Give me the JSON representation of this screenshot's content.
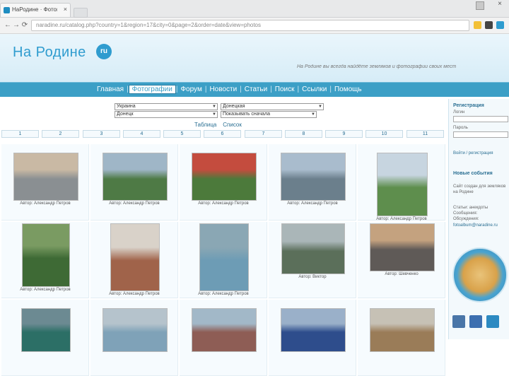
{
  "browser": {
    "tab_title": "НаРодине · Фотографии",
    "close_glyph": "×",
    "url": "naradine.ru/catalog.php?country=1&region=17&city=0&page=2&order=date&view=photos",
    "back": "←",
    "forward": "→",
    "reload": "⟳"
  },
  "site": {
    "logo_text": "На Родине",
    "logo_badge": "ru",
    "slogan": "На Родине вы всегда найдёте земляков и фотографии своих мест",
    "accent": "#3c9fc6"
  },
  "nav": {
    "items": [
      "Главная",
      "Фотографии",
      "Форум",
      "Новости",
      "Статьи",
      "Поиск",
      "Ссылки",
      "Помощь"
    ],
    "active_index": 1
  },
  "filters": {
    "country": "Украина",
    "region": "Донецкая",
    "city": "Донецк",
    "sort": "Показывать сначала"
  },
  "view_links": [
    "Таблица",
    "Список"
  ],
  "pager": [
    "1",
    "2",
    "3",
    "4",
    "5",
    "6",
    "7",
    "8",
    "9",
    "10",
    "11"
  ],
  "photos": [
    {
      "color": "#8a8f92",
      "alt": "#c9b9a4",
      "author": "Автор: Александр Петров"
    },
    {
      "color": "#4e7a45",
      "alt": "#9fb6c7",
      "author": "Автор: Александр Петров"
    },
    {
      "color": "#4c7a3b",
      "alt": "#c44c3e",
      "author": "Автор: Александр Петров"
    },
    {
      "color": "#6b7f8c",
      "alt": "#a9bccd",
      "author": "Автор: Александр Петров"
    },
    {
      "color": "#5e8e4d",
      "alt": "#c7d5e0",
      "author": "Автор: Александр Петров"
    },
    {
      "color": "#3e6a35",
      "alt": "#7a9b62",
      "author": "Автор: Александр Петров"
    },
    {
      "color": "#a0634a",
      "alt": "#d9d2c9",
      "author": "Автор: Александр Петров"
    },
    {
      "color": "#6d9cb5",
      "alt": "#8aa7b4",
      "author": "Автор: Александр Петров"
    },
    {
      "color": "#5b6f5a",
      "alt": "#aab6b8",
      "author": "Автор: Виктор"
    },
    {
      "color": "#5f5a57",
      "alt": "#c4a27f",
      "author": "Автор: Шевченко"
    },
    {
      "color": "#2c6f66",
      "alt": "#6c8a92",
      "author": ""
    },
    {
      "color": "#7fa2b8",
      "alt": "#b5c3cc",
      "author": ""
    },
    {
      "color": "#8e5d55",
      "alt": "#a2b8c8",
      "author": ""
    },
    {
      "color": "#2e4d8c",
      "alt": "#9ab0c9",
      "author": ""
    },
    {
      "color": "#9a7c58",
      "alt": "#c6c1b5",
      "author": ""
    }
  ],
  "sidebar": {
    "login_title": "Регистрация",
    "login_label": "Логин",
    "password_label": "Пароль",
    "login_button": "Войти / регистрация",
    "section2_title": "Новые события",
    "section2_text": [
      "Сайт создан для земляков",
      "на Родине"
    ],
    "section3_text": [
      "Статьи: анекдоты",
      "Сообщения:",
      "Обсуждения:",
      "fotoalbum@naradine.ru"
    ],
    "social": [
      {
        "name": "vk",
        "color": "#4a76a8"
      },
      {
        "name": "odnoklassniki",
        "color": "#3c6fb0"
      },
      {
        "name": "mail",
        "color": "#2c8ac2"
      }
    ]
  }
}
